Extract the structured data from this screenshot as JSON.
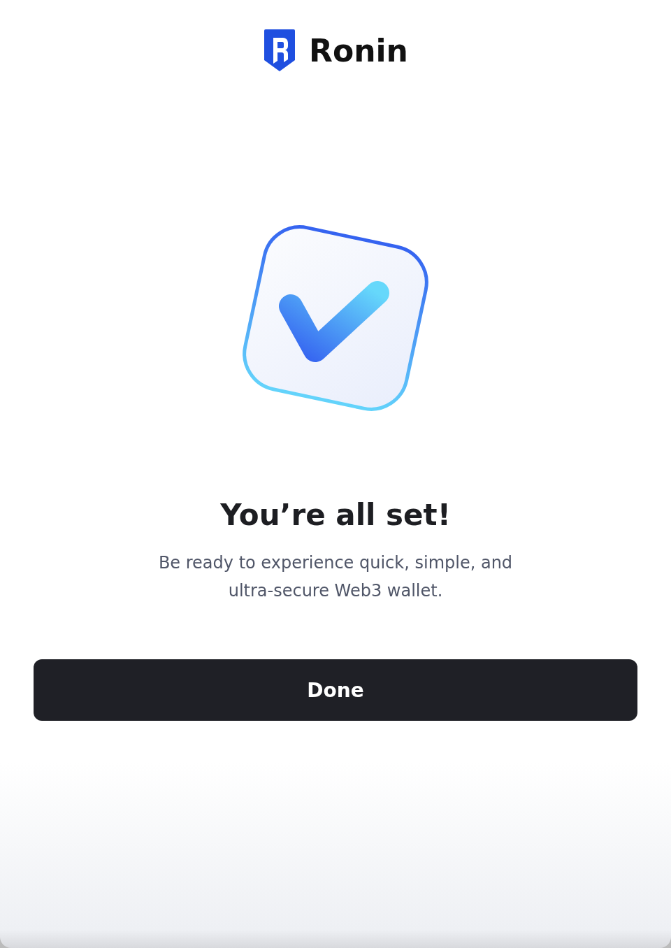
{
  "brand": {
    "name": "Ronin"
  },
  "title": "You’re all set!",
  "subtitle": "Be ready to experience quick, simple, and ultra-secure Web3 wallet.",
  "buttons": [
    {
      "label": "Done",
      "kind": "primary"
    }
  ]
}
